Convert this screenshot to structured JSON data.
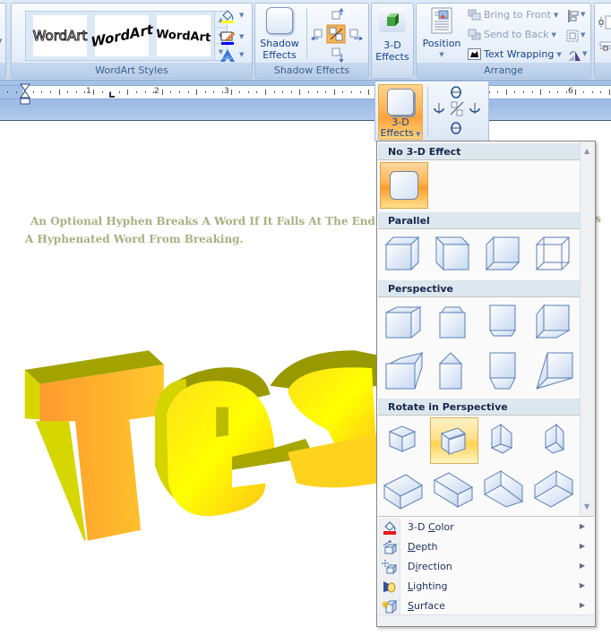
{
  "ribbon": {
    "wordart_styles": {
      "label": "WordArt Styles",
      "gallery": [
        "WordArt",
        "WordArt",
        "WordArt"
      ]
    },
    "shadow_effects": {
      "label": "Shadow Effects",
      "button_line1": "Shadow",
      "button_line2": "Effects"
    },
    "three_d": {
      "button_line1": "3-D",
      "button_line2": "Effects"
    },
    "arrange": {
      "label": "Arrange",
      "position_label": "Position",
      "bring_to_front": "Bring to Front",
      "send_to_back": "Send to Back",
      "text_wrapping": "Text Wrapping"
    },
    "colors": {
      "fill_bar": "#ffff00",
      "line_bar": "#0000ff"
    }
  },
  "ruler": {
    "numbers": [
      "1",
      "2",
      "3",
      "6"
    ]
  },
  "document": {
    "line1": "An Optional Hyphen Breaks A Word If It Falls At The End Of",
    "line1_tail": "nts",
    "line2": "A Hyphenated  Word From Breaking.",
    "wordart_text": "Test"
  },
  "fx_panel": {
    "button_line1": "3-D",
    "button_line2": "Effects"
  },
  "menu": {
    "sections": [
      {
        "title": "No 3-D Effect"
      },
      {
        "title": "Parallel"
      },
      {
        "title": "Perspective"
      },
      {
        "title": "Rotate in Perspective"
      }
    ],
    "items": [
      {
        "label": "3-D Color",
        "icon": "paint-bucket-icon",
        "color_bar": "#e61919"
      },
      {
        "label": "Depth",
        "icon": "depth-icon"
      },
      {
        "label": "Direction",
        "icon": "direction-icon"
      },
      {
        "label": "Lighting",
        "icon": "lighting-icon"
      },
      {
        "label": "Surface",
        "icon": "surface-icon"
      }
    ],
    "selected_rotate_index": 1
  },
  "theme": {
    "accent_orange": "#ffb352",
    "ribbon_text": "#15428b",
    "doc_text": "#a5b281"
  }
}
